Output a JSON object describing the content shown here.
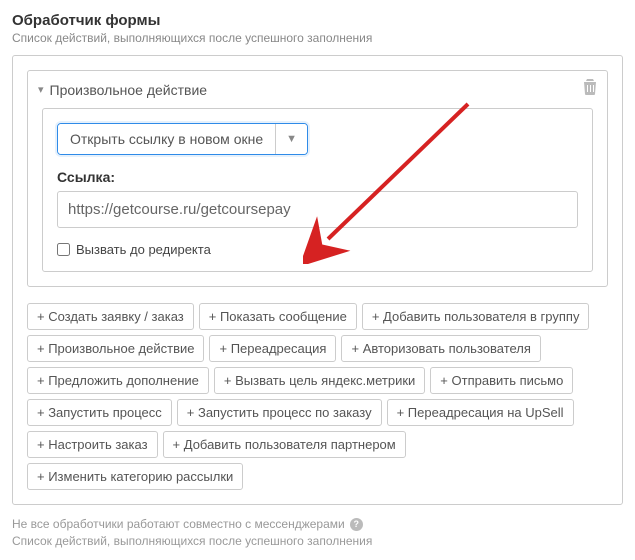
{
  "header": {
    "title": "Обработчик формы",
    "subtitle": "Список действий, выполняющихся после успешного заполнения"
  },
  "action_card": {
    "title": "Произвольное действие",
    "select_value": "Открыть ссылку в новом окне",
    "url_label": "Ссылка:",
    "url_value": "https://getcourse.ru/getcoursepay",
    "checkbox_label": "Вызвать до редиректа"
  },
  "chips": [
    "+ Создать заявку / заказ",
    "+ Показать сообщение",
    "+ Добавить пользователя в группу",
    "+ Произвольное действие",
    "+ Переадресация",
    "+ Авторизовать пользователя",
    "+ Предложить дополнение",
    "+ Вызвать цель яндекс.метрики",
    "+ Отправить письмо",
    "+ Запустить процесс",
    "+ Запустить процесс по заказу",
    "+ Переадресация на UpSell",
    "+ Настроить заказ",
    "+ Добавить пользователя партнером",
    "+ Изменить категорию рассылки"
  ],
  "footer": {
    "note": "Не все обработчики работают совместно с мессенджерами",
    "sub": "Список действий, выполняющихся после успешного заполнения"
  }
}
